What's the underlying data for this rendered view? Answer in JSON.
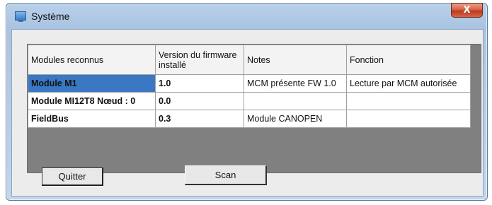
{
  "window": {
    "title": "Système",
    "close_label": "X"
  },
  "table": {
    "headers": [
      "Modules reconnus",
      "Version du firmware installé",
      "Notes",
      "Fonction"
    ],
    "rows": [
      {
        "module": "Module M1",
        "version": "1.0",
        "notes": "MCM présente FW 1.0",
        "fonction": "Lecture par MCM autorisée",
        "selected": true
      },
      {
        "module": "Module MI12T8 Nœud : 0",
        "version": "0.0",
        "notes": "",
        "fonction": "",
        "selected": false
      },
      {
        "module": "FieldBus",
        "version": "0.3",
        "notes": "Module CANOPEN",
        "fonction": "",
        "selected": false
      }
    ]
  },
  "buttons": {
    "quit_label": "Quitter",
    "scan_label": "Scan"
  },
  "colors": {
    "module_text": "#2c7a1f",
    "selection": "#3a78c4",
    "close_button": "#c0381d"
  }
}
